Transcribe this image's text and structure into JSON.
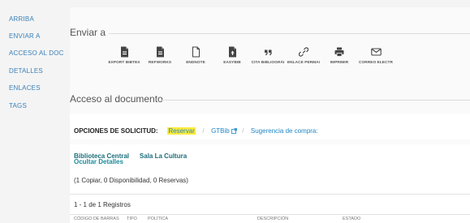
{
  "sidebar": {
    "items": [
      {
        "label": "ARRIBA"
      },
      {
        "label": "ENVIAR A"
      },
      {
        "label": "ACCESO AL DOCUM"
      },
      {
        "label": "DETALLES"
      },
      {
        "label": "ENLACES"
      },
      {
        "label": "TAGS"
      }
    ]
  },
  "send": {
    "title": "Enviar a",
    "tools": [
      {
        "label": "EXPORT BIBTEX",
        "icon": "bibtex-file-icon"
      },
      {
        "label": "REFWORKS",
        "icon": "refworks-file-icon"
      },
      {
        "label": "ENDNOTE",
        "icon": "endnote-file-icon"
      },
      {
        "label": "EASYBIB",
        "icon": "easybib-file-icon"
      },
      {
        "label": "CITA BIBLIOGRÁI",
        "icon": "quote-icon"
      },
      {
        "label": "ENLACE PERMAI",
        "icon": "link-icon"
      },
      {
        "label": "IMPRIMIR",
        "icon": "printer-icon"
      },
      {
        "label": "CORREO ELECTR",
        "icon": "envelope-icon"
      }
    ]
  },
  "access": {
    "title": "Acceso al documento",
    "options_label": "OPCIONES DE SOLICITUD:",
    "reserve_link": "Reservar",
    "gtbib_link": "GTBib",
    "suggest_link": "Sugerencia de compra:",
    "library": "Biblioteca Central",
    "location": "Sala La Cultura",
    "hide_details": "Ocultar Detalles",
    "counts": "(1 Copiar, 0 Disponibilidad, 0 Reservas)",
    "records": "1 - 1 de 1 Registros",
    "columns": [
      "CÓDIGO DE BARRAS",
      "TIPO",
      "POLÍTICA",
      "DESCRIPCIÓN",
      "ESTADO"
    ]
  }
}
